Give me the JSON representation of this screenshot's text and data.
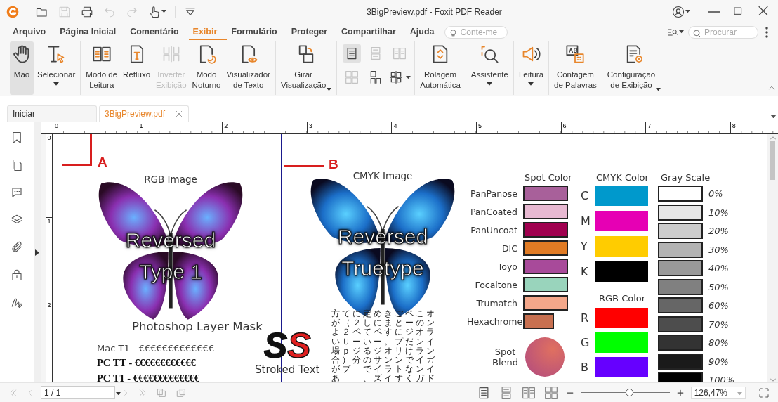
{
  "window": {
    "title": "3BigPreview.pdf - Foxit PDF Reader"
  },
  "menu": [
    {
      "label": "Arquivo",
      "selected": false
    },
    {
      "label": "Página Inicial",
      "selected": false
    },
    {
      "label": "Comentário",
      "selected": false
    },
    {
      "label": "Exibir",
      "selected": true
    },
    {
      "label": "Formulário",
      "selected": false
    },
    {
      "label": "Proteger",
      "selected": false
    },
    {
      "label": "Compartilhar",
      "selected": false
    },
    {
      "label": "Ajuda",
      "selected": false
    }
  ],
  "tell_me": {
    "placeholder": "Conte-me"
  },
  "search": {
    "placeholder": "Procurar"
  },
  "ribbon": [
    [
      {
        "kind": "hand",
        "label": "Mão",
        "selected": true,
        "disabled": false,
        "dropdown": false
      },
      {
        "kind": "select",
        "label": "Selecionar",
        "selected": false,
        "disabled": false,
        "dropdown": true
      }
    ],
    [
      {
        "kind": "read-mode",
        "label": "Modo de\nLeitura",
        "selected": false,
        "disabled": false,
        "dropdown": false
      },
      {
        "kind": "reflow",
        "label": "Refluxo",
        "selected": false,
        "disabled": false,
        "dropdown": false
      },
      {
        "kind": "reverse-view",
        "label": "Inverter\nExibição",
        "selected": false,
        "disabled": true,
        "dropdown": false
      },
      {
        "kind": "night-mode",
        "label": "Modo\nNoturno",
        "selected": false,
        "disabled": false,
        "dropdown": false
      },
      {
        "kind": "text-viewer",
        "label": "Visualizador\nde Texto",
        "selected": false,
        "disabled": false,
        "dropdown": false
      }
    ],
    [
      {
        "kind": "rotate",
        "label": "Girar\nVisualização",
        "selected": false,
        "disabled": false,
        "dropdown": true
      }
    ],
    [
      {
        "kind": "small",
        "buttons": [
          {
            "kind": "single",
            "selected": true,
            "disabled": false
          },
          {
            "kind": "continuous",
            "selected": false,
            "disabled": true
          },
          {
            "kind": "facing",
            "selected": false,
            "disabled": true
          },
          {
            "kind": "cont-facing",
            "selected": false,
            "disabled": true
          },
          {
            "kind": "cover",
            "selected": false,
            "disabled": false
          },
          {
            "kind": "split",
            "selected": false,
            "disabled": false
          }
        ]
      }
    ],
    [
      {
        "kind": "auto-scroll",
        "label": "Rolagem\nAutomática",
        "selected": false,
        "disabled": false,
        "dropdown": false
      }
    ],
    [
      {
        "kind": "assistant",
        "label": "Assistente",
        "selected": false,
        "disabled": false,
        "dropdown": true
      }
    ],
    [
      {
        "kind": "read-aloud",
        "label": "Leitura",
        "selected": false,
        "disabled": false,
        "dropdown": true
      }
    ],
    [
      {
        "kind": "word-count",
        "label": "Contagem\nde Palavras",
        "selected": false,
        "disabled": false,
        "dropdown": false
      }
    ],
    [
      {
        "kind": "view-settings",
        "label": "Configuração\nde Exibição",
        "selected": false,
        "disabled": false,
        "dropdown": true
      }
    ]
  ],
  "tabs": [
    {
      "label": "Iniciar",
      "selected": false,
      "closable": false
    },
    {
      "label": "3BigPreview.pdf",
      "selected": true,
      "closable": true
    }
  ],
  "ruler": {
    "marks": [
      "0",
      "1",
      "2",
      "3",
      "4",
      "5",
      "6",
      "7",
      "8"
    ],
    "vertical_marks": [
      "0",
      "1",
      "2"
    ]
  },
  "doc": {
    "annotations": [
      "A",
      "B"
    ],
    "images": [
      {
        "kind": "purple",
        "caption": "RGB Image",
        "overlay": "Reversed\nType 1"
      },
      {
        "kind": "blue",
        "caption": "CMYK Image",
        "overlay": "Reversed\nTruetype"
      }
    ],
    "mask_caption": "Photoshop Layer Mask",
    "font_samples": [
      {
        "kind": "sans",
        "text": "Mac T1 - €€€€€€€€€€€€€"
      },
      {
        "kind": "serif",
        "text": "PC TT - €€€€€€€€€€€€"
      },
      {
        "kind": "serif",
        "text": "PC T1 - €€€€€€€€€€€€€"
      }
    ],
    "stroked": {
      "letters": [
        "S",
        "S"
      ],
      "caption": "Stroked Text"
    },
    "japanese_columns": [
      "方がよい場合があ",
      "て（２Ｕｐ）プ",
      "に２ページ分",
      "定しているので、",
      "めにページサイズ",
      "きます。オンライ",
      "ごとにプリントす",
      "ページだけでなく",
      "このオンラインガ",
      "オンラインガイド"
    ],
    "spot_heading": "Spot Color",
    "spot_colors": [
      {
        "label": "PanPanose",
        "color": "#a8609a"
      },
      {
        "label": "PanCoated",
        "color": "#e8b9d2"
      },
      {
        "label": "PanUncoat",
        "color": "#a0004f"
      },
      {
        "label": "DIC",
        "color": "#e07b24"
      },
      {
        "label": "Toyo",
        "color": "#a84a9a"
      },
      {
        "label": "Focaltone",
        "color": "#99d4bc"
      },
      {
        "label": "Trumatch",
        "color": "#f4a78a"
      },
      {
        "label": "Hexachrome",
        "color": "#c87050"
      }
    ],
    "spot_blend": "Spot\nBlend",
    "cmyk_heading": "CMYK Color",
    "cmyk_colors": [
      {
        "label": "C",
        "color": "#0099cc"
      },
      {
        "label": "M",
        "color": "#e600b4"
      },
      {
        "label": "Y",
        "color": "#ffcc00"
      },
      {
        "label": "K",
        "color": "#000000"
      }
    ],
    "rgb_heading": "RGB Color",
    "rgb_colors": [
      {
        "label": "R",
        "color": "#ff0000"
      },
      {
        "label": "G",
        "color": "#00ff00"
      },
      {
        "label": "B",
        "color": "#6600ff"
      }
    ],
    "gray_heading": "Gray Scale",
    "gray_levels": [
      {
        "label": "0%",
        "color": "#ffffff"
      },
      {
        "label": "10%",
        "color": "#e6e6e6"
      },
      {
        "label": "20%",
        "color": "#cccccc"
      },
      {
        "label": "30%",
        "color": "#b3b3b3"
      },
      {
        "label": "40%",
        "color": "#999999"
      },
      {
        "label": "50%",
        "color": "#808080"
      },
      {
        "label": "60%",
        "color": "#666666"
      },
      {
        "label": "70%",
        "color": "#4d4d4d"
      },
      {
        "label": "80%",
        "color": "#333333"
      },
      {
        "label": "90%",
        "color": "#1a1a1a"
      },
      {
        "label": "100%",
        "color": "#000000"
      }
    ]
  },
  "status_bar": {
    "page": "1 / 1",
    "zoom": "126,47%",
    "zoom_slider": {
      "level": 0.55
    }
  }
}
